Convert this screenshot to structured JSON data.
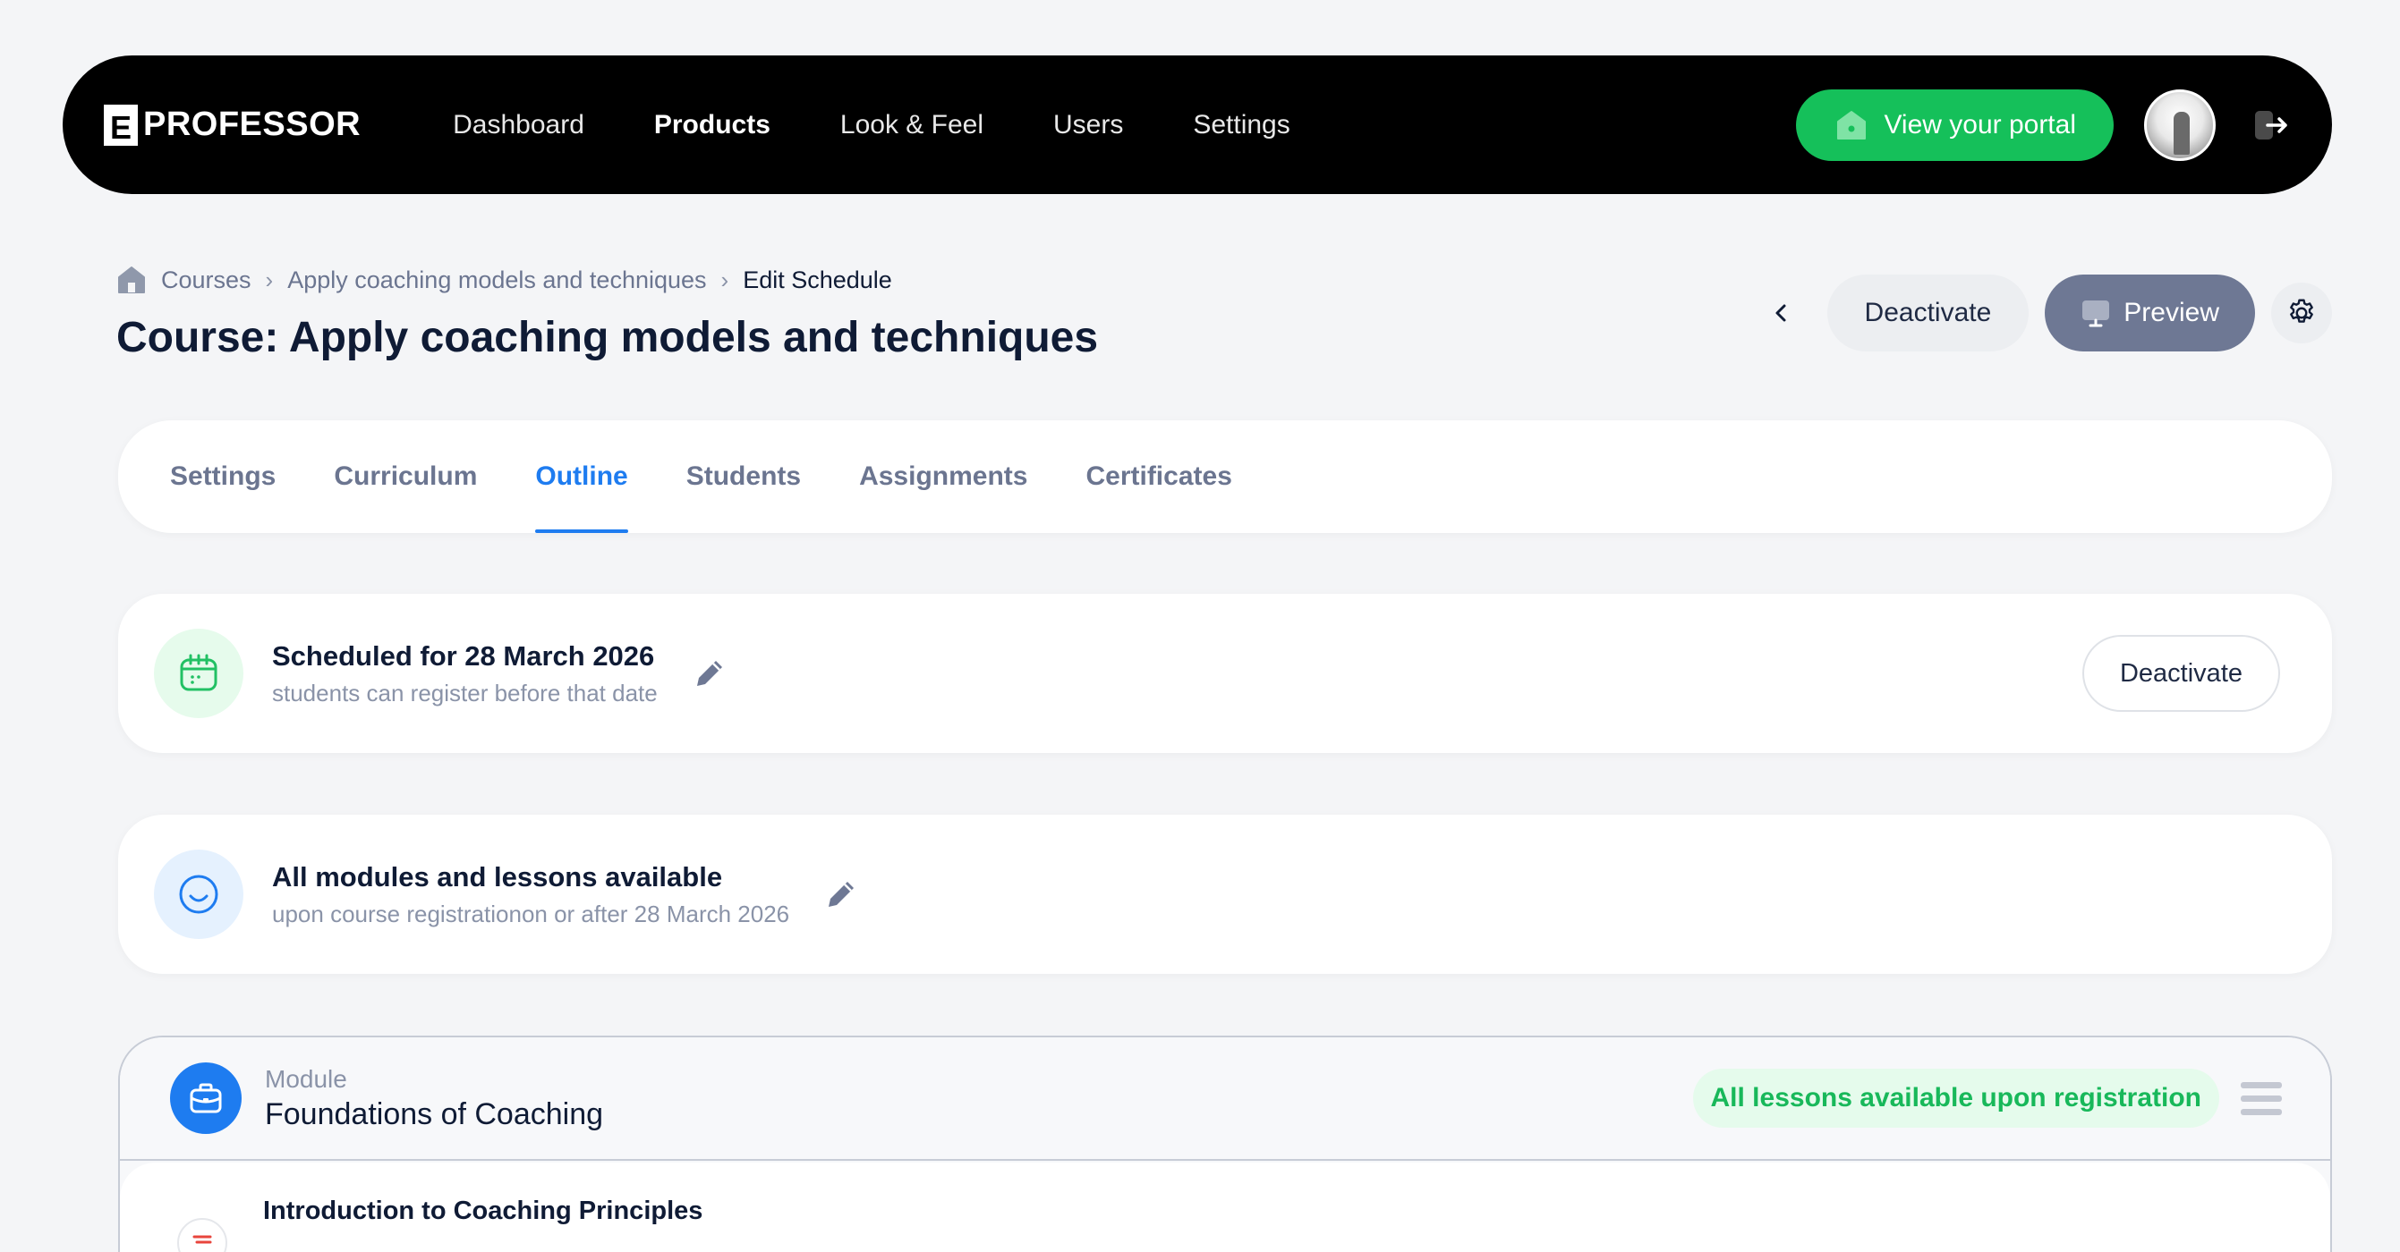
{
  "brand": {
    "mark": "E",
    "name": "PROFESSOR"
  },
  "nav": {
    "items": [
      {
        "label": "Dashboard"
      },
      {
        "label": "Products",
        "active": true
      },
      {
        "label": "Look & Feel"
      },
      {
        "label": "Users"
      },
      {
        "label": "Settings"
      }
    ],
    "portal_button": "View your portal",
    "colors": {
      "bar": "#000000",
      "portal": "#15c05a"
    }
  },
  "breadcrumb": {
    "items": [
      "Courses",
      "Apply coaching models and techniques",
      "Edit Schedule"
    ]
  },
  "page": {
    "title": "Course: Apply coaching models and techniques",
    "actions": {
      "deactivate": "Deactivate",
      "preview": "Preview"
    }
  },
  "tabs": [
    {
      "label": "Settings"
    },
    {
      "label": "Curriculum"
    },
    {
      "label": "Outline",
      "active": true
    },
    {
      "label": "Students"
    },
    {
      "label": "Assignments"
    },
    {
      "label": "Certificates"
    }
  ],
  "schedule": {
    "title": "Scheduled for 28 March 2026",
    "subtitle": "students can register before that date",
    "button": "Deactivate"
  },
  "availability": {
    "title": "All modules and lessons available",
    "subtitle": "upon course registrationon or after 28 March 2026"
  },
  "module": {
    "label": "Module",
    "title": "Foundations of Coaching",
    "badge": "All lessons available upon registration",
    "lessons": [
      {
        "title": "Introduction to Coaching Principles"
      }
    ]
  },
  "accent": "#1e7cf0"
}
